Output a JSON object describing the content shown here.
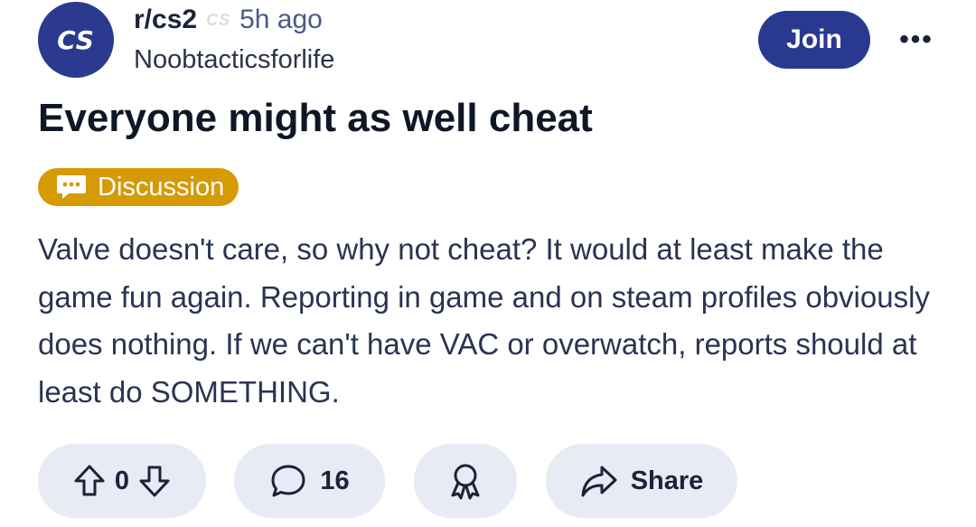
{
  "post": {
    "subreddit": "r/cs2",
    "subreddit_flair_logo": "CS",
    "time_ago": "5h ago",
    "author": "Noobtacticsforlife",
    "avatar_text": "CS",
    "join_label": "Join",
    "more_label": "•••",
    "title": "Everyone might as well cheat",
    "flair": {
      "label": "Discussion",
      "icon": "speech-bubble-dots-icon",
      "color": "#d69a05"
    },
    "body": "Valve doesn't care, so why not cheat? It would at least make the game fun again. Reporting in game and on steam profiles obviously does nothing. If we can't have VAC or overwatch, reports should at least do SOMETHING."
  },
  "actions": {
    "vote_count": "0",
    "comment_count": "16",
    "share_label": "Share",
    "upvote_icon": "arrow-up-icon",
    "downvote_icon": "arrow-down-icon",
    "comment_icon": "comment-bubble-icon",
    "award_icon": "award-ribbon-icon",
    "share_icon": "share-arrow-icon"
  },
  "colors": {
    "accent": "#2a3990",
    "action_bg": "#e8eaf4"
  }
}
